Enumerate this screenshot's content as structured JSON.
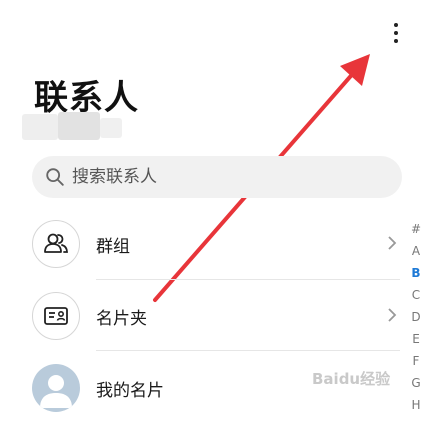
{
  "header": {
    "title": "联系人",
    "more_icon": "more-vertical-icon"
  },
  "search": {
    "placeholder": "搜索联系人",
    "value": ""
  },
  "entries": [
    {
      "label": "群组",
      "icon": "group-icon"
    },
    {
      "label": "名片夹",
      "icon": "business-card-icon"
    },
    {
      "label": "我的名片",
      "icon": "user-avatar"
    }
  ],
  "index": [
    "#",
    "A",
    "B",
    "C",
    "D",
    "E",
    "F",
    "G",
    "H"
  ],
  "index_active": "B",
  "watermark": "Baidu经验",
  "colors": {
    "accent": "#1e7ad6",
    "arrow": "#e8353a"
  }
}
